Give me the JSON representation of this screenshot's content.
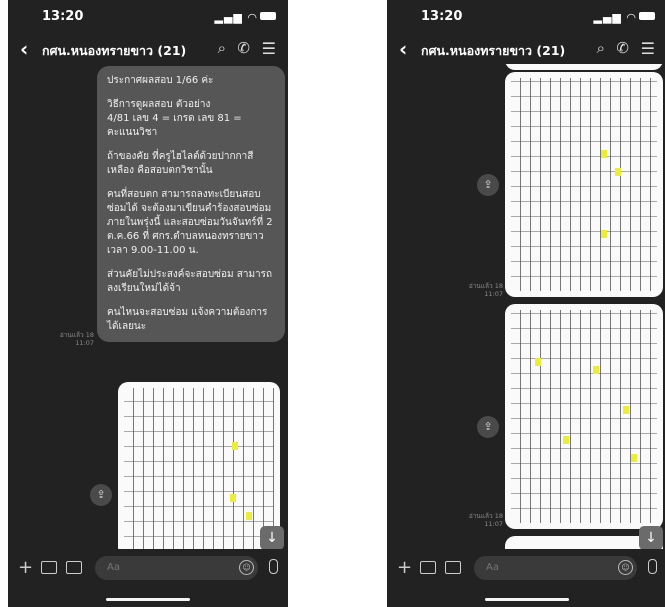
{
  "status": {
    "time": "13:20"
  },
  "header": {
    "back_icon": "chevron-left-icon",
    "title": "กศน.หนองทรายขาว (21)"
  },
  "message": {
    "paragraphs": [
      "ประกาศผลสอบ 1/66 ค่ะ",
      "วิธีการดูผลสอบ ตัวอย่าง\n4/81 เลข 4 = เกรด เลข 81 = คะแนนวิชา",
      "ถ้าของคัย ที่ครูไฮไลต์ด้วยปากกาสีเหลือง คือสอบตกวิชานั้น",
      "คนที่สอบตก สามารถลงทะเบียนสอบซ่อมได้ จะต้องมาเขียนคำร้องสอบซ่อมภายในพรุ่งนี้ และสอบซ่อมวันจันทร์ที่ 2 ต.ค.66 ที่ ศกร.ตำบลหนองทรายขาว เวลา 9.00-11.00 น.",
      "ส่วนคัยไม่ประสงค์จะสอบซ่อม สามารถลงเรียนใหม่ได้จ้า",
      "คนไหนจะสอบซ่อม แจ้งความต้องการได้เลยนะ"
    ],
    "read_mark": "อ่านแล้ว 18\n11:07"
  },
  "image_read_mark": "อ่านแล้ว 18\n11:07",
  "input": {
    "placeholder": "Aa"
  },
  "colors": {
    "bg": "#222222",
    "bubble": "#565656",
    "highlight": "#ecec3a"
  }
}
